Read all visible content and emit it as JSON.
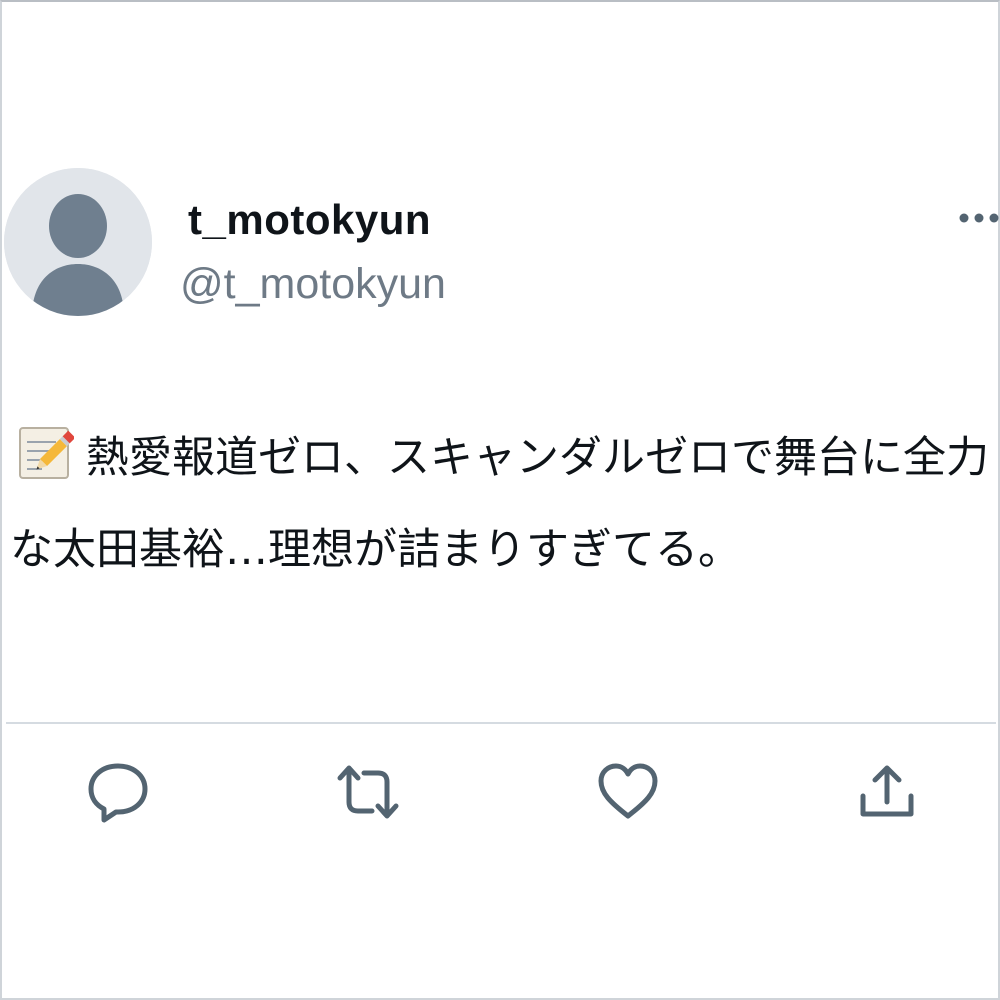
{
  "tweet": {
    "display_name": "t_motokyun",
    "handle": "@t_motokyun",
    "text": "熱愛報道ゼロ、スキャンダルゼロで舞台に全力な太田基裕…理想が詰まりすぎてる。"
  },
  "icons": {
    "avatar": "default-avatar-icon",
    "more": "more-options-icon",
    "memo": "memo-pencil-icon",
    "reply": "reply-icon",
    "retweet": "retweet-icon",
    "like": "heart-icon",
    "share": "share-icon"
  },
  "colors": {
    "icon_gray": "#536471",
    "text": "#0f1419",
    "handle": "#6e7a86",
    "avatar_bg": "#e1e5ea",
    "avatar_figure": "#6f7f8f"
  }
}
